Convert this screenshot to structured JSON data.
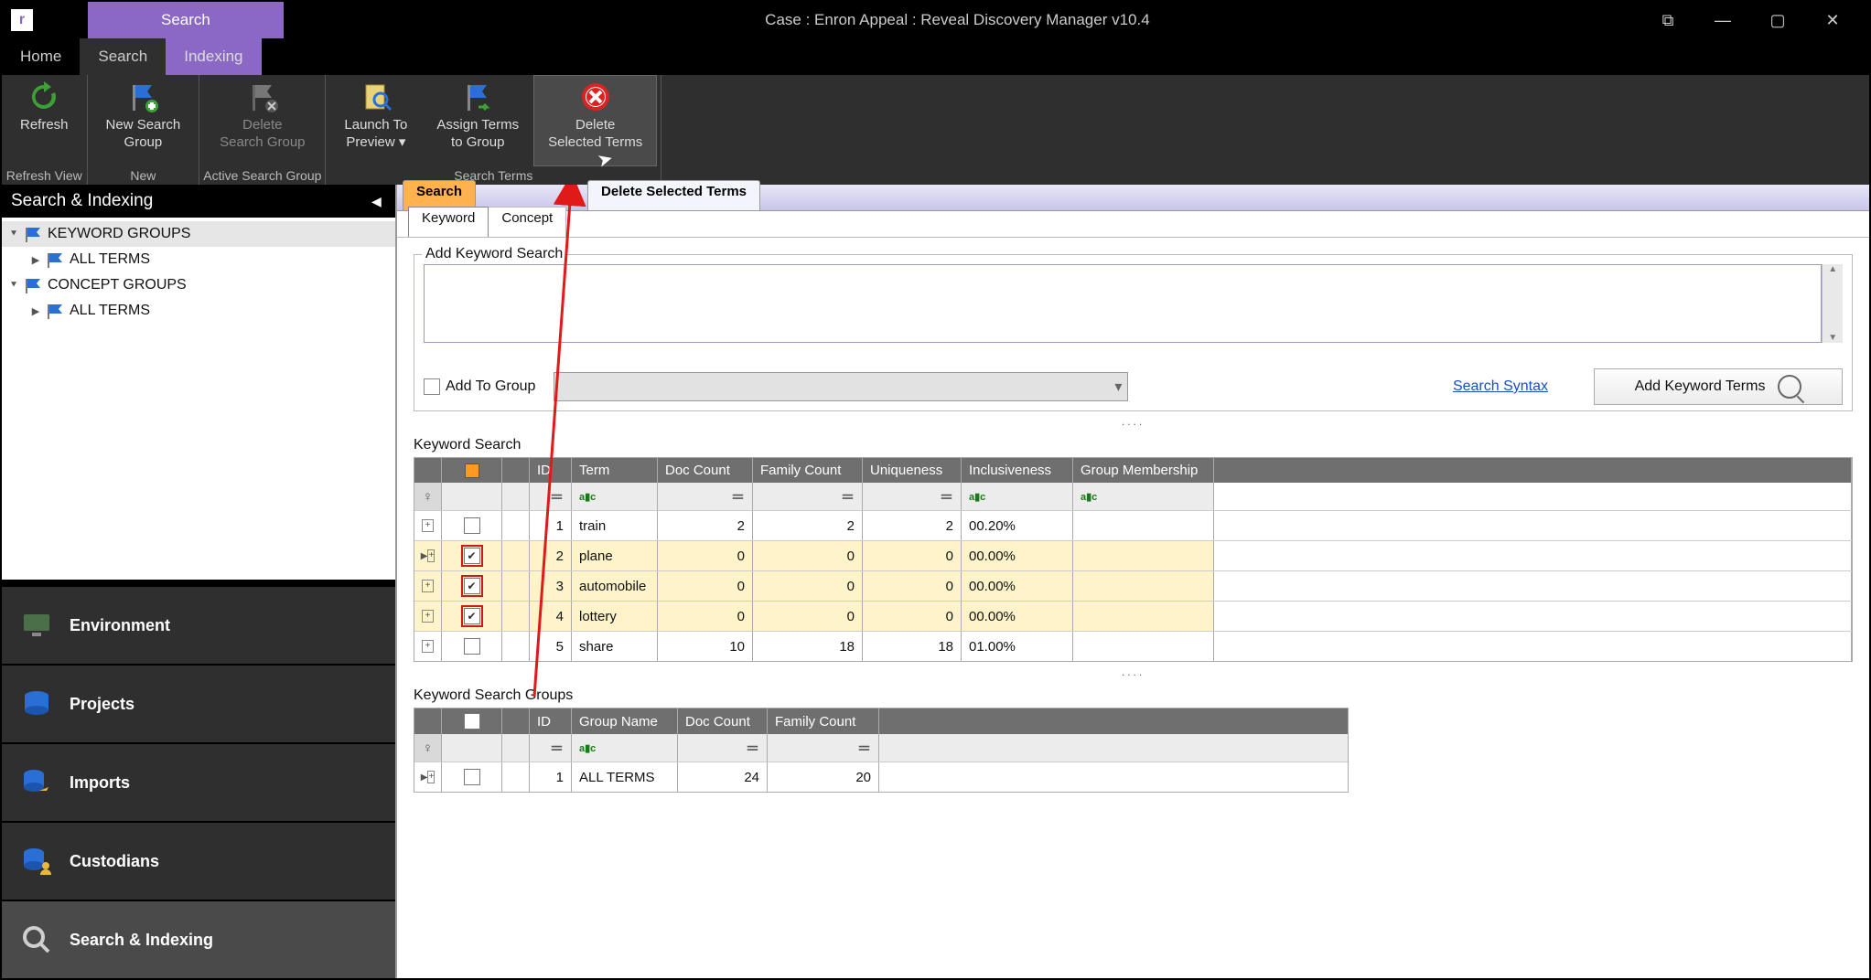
{
  "window": {
    "app_initial": "r",
    "tab": "Search",
    "title": "Case : Enron Appeal : Reveal Discovery Manager  v10.4"
  },
  "menu": {
    "home": "Home",
    "search": "Search",
    "indexing": "Indexing"
  },
  "ribbon": {
    "refresh": "Refresh",
    "new_group_l1": "New Search",
    "new_group_l2": "Group",
    "delete_group_l1": "Delete",
    "delete_group_l2": "Search Group",
    "launch_l1": "Launch To",
    "launch_l2": "Preview ▾",
    "assign_l1": "Assign Terms",
    "assign_l2": "to Group",
    "del_terms_l1": "Delete",
    "del_terms_l2": "Selected Terms",
    "grp_refresh": "Refresh View",
    "grp_new": "New",
    "grp_active": "Active Search Group",
    "grp_terms": "Search Terms"
  },
  "sidebar": {
    "title": "Search & Indexing",
    "tree": {
      "n0": "KEYWORD GROUPS",
      "n0_0": "ALL TERMS",
      "n1": "CONCEPT GROUPS",
      "n1_0": "ALL TERMS"
    },
    "nav": {
      "env": "Environment",
      "proj": "Projects",
      "imp": "Imports",
      "cust": "Custodians",
      "si": "Search & Indexing"
    }
  },
  "tabs": {
    "search": "Search",
    "dst": "Delete Selected Terms",
    "keyword": "Keyword",
    "concept": "Concept"
  },
  "add": {
    "legend": "Add Keyword Search",
    "addtogroup": "Add To Group",
    "syntax": "Search Syntax",
    "addbtn": "Add Keyword Terms"
  },
  "ks": {
    "title": "Keyword Search",
    "cols": {
      "id": "ID",
      "term": "Term",
      "dc": "Doc Count",
      "fc": "Family Count",
      "un": "Uniqueness",
      "inc": "Inclusiveness",
      "gm": "Group Membership"
    },
    "rows": [
      {
        "id": "1",
        "term": "train",
        "dc": "2",
        "fc": "2",
        "un": "2",
        "inc": "00.20%",
        "chk": false,
        "sel": false
      },
      {
        "id": "2",
        "term": "plane",
        "dc": "0",
        "fc": "0",
        "un": "0",
        "inc": "00.00%",
        "chk": true,
        "sel": true,
        "cursor": true
      },
      {
        "id": "3",
        "term": "automobile",
        "dc": "0",
        "fc": "0",
        "un": "0",
        "inc": "00.00%",
        "chk": true,
        "sel": true
      },
      {
        "id": "4",
        "term": "lottery",
        "dc": "0",
        "fc": "0",
        "un": "0",
        "inc": "00.00%",
        "chk": true,
        "sel": true
      },
      {
        "id": "5",
        "term": "share",
        "dc": "10",
        "fc": "18",
        "un": "18",
        "inc": "01.00%",
        "chk": false,
        "sel": false
      }
    ]
  },
  "ksg": {
    "title": "Keyword Search Groups",
    "cols": {
      "id": "ID",
      "gn": "Group Name",
      "dc": "Doc Count",
      "fc": "Family Count"
    },
    "rows": [
      {
        "id": "1",
        "gn": "ALL TERMS",
        "dc": "24",
        "fc": "20"
      }
    ]
  },
  "glyph": {
    "eq": "＝",
    "abc": "a▮c"
  }
}
